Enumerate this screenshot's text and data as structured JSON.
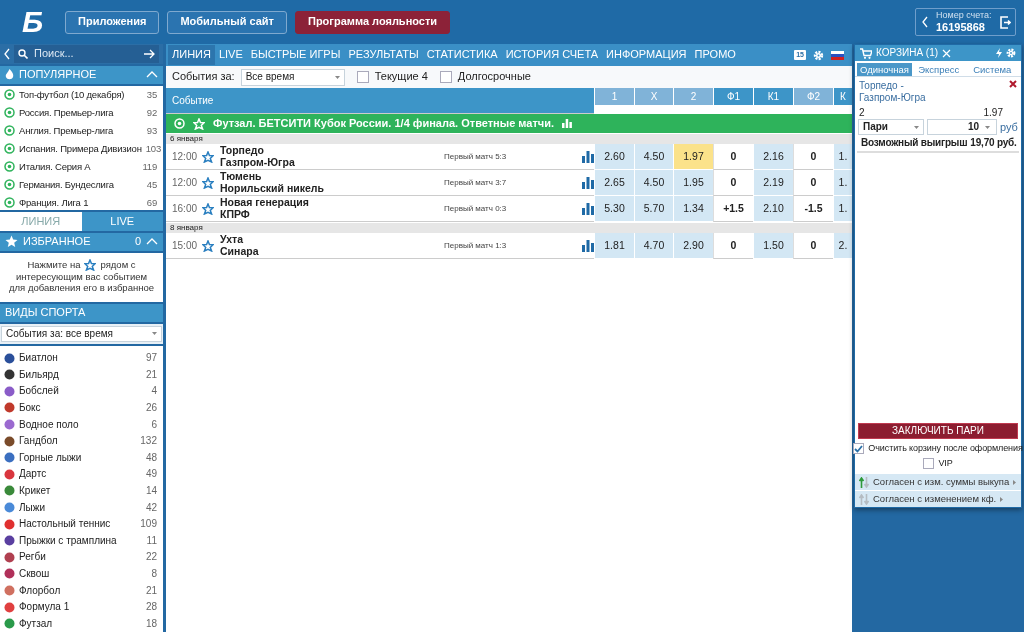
{
  "header": {
    "logo": "Б",
    "buttons": [
      {
        "label": "Приложения",
        "kind": "outline"
      },
      {
        "label": "Мобильный сайт",
        "kind": "outline"
      },
      {
        "label": "Программа лояльности",
        "kind": "accent"
      }
    ],
    "account": {
      "label": "Номер счета:",
      "number": "16195868"
    }
  },
  "search": {
    "placeholder": "Поиск..."
  },
  "nav": {
    "tabs": [
      {
        "label": "ЛИНИЯ",
        "selected": true
      },
      {
        "label": "LIVE",
        "selected": false
      },
      {
        "label": "БЫСТРЫЕ ИГРЫ",
        "selected": false
      },
      {
        "label": "РЕЗУЛЬТАТЫ",
        "selected": false
      },
      {
        "label": "СТАТИСТИКА",
        "selected": false
      },
      {
        "label": "ИСТОРИЯ СЧЕТА",
        "selected": false
      },
      {
        "label": "ИНФОРМАЦИЯ",
        "selected": false
      },
      {
        "label": "ПРОМО",
        "selected": false
      }
    ],
    "badge": "15"
  },
  "popular": {
    "title": "ПОПУЛЯРНОЕ",
    "items": [
      {
        "name": "Топ-футбол (10 декабря)",
        "count": "35"
      },
      {
        "name": "Россия. Премьер-лига",
        "count": "92"
      },
      {
        "name": "Англия. Премьер-лига",
        "count": "93"
      },
      {
        "name": "Испания. Примера Дивизион",
        "count": "103"
      },
      {
        "name": "Италия. Серия А",
        "count": "119"
      },
      {
        "name": "Германия. Бундеслига",
        "count": "45"
      },
      {
        "name": "Франция. Лига 1",
        "count": "69"
      }
    ]
  },
  "side_tabs": [
    {
      "label": "ЛИНИЯ",
      "selected": false
    },
    {
      "label": "LIVE",
      "selected": true
    }
  ],
  "favorites": {
    "title": "ИЗБРАННОЕ",
    "count": "0",
    "hint_start": "Нажмите на",
    "hint_mid": "рядом с",
    "hint_end": "интересующим вас событием для добавления его в избранное"
  },
  "sports": {
    "title": "ВИДЫ СПОРТА",
    "filter": "События за: все время",
    "items": [
      {
        "name": "Биатлон",
        "count": "97",
        "color": "#2a4f9a"
      },
      {
        "name": "Бильярд",
        "count": "21",
        "color": "#333333"
      },
      {
        "name": "Бобслей",
        "count": "4",
        "color": "#8a5cc8"
      },
      {
        "name": "Бокс",
        "count": "26",
        "color": "#c0392b"
      },
      {
        "name": "Водное поло",
        "count": "6",
        "color": "#9b6ad0"
      },
      {
        "name": "Гандбол",
        "count": "132",
        "color": "#7a4b2a"
      },
      {
        "name": "Горные лыжи",
        "count": "48",
        "color": "#3b6fc0"
      },
      {
        "name": "Дартс",
        "count": "49",
        "color": "#d9363e"
      },
      {
        "name": "Крикет",
        "count": "14",
        "color": "#3a8a3a"
      },
      {
        "name": "Лыжи",
        "count": "42",
        "color": "#4a8ad8"
      },
      {
        "name": "Настольный теннис",
        "count": "109",
        "color": "#e0302f"
      },
      {
        "name": "Прыжки с трамплина",
        "count": "11",
        "color": "#5a3fa0"
      },
      {
        "name": "Регби",
        "count": "22",
        "color": "#b04050"
      },
      {
        "name": "Сквош",
        "count": "8",
        "color": "#b0305a"
      },
      {
        "name": "Флорбол",
        "count": "21",
        "color": "#d07060"
      },
      {
        "name": "Формула 1",
        "count": "28",
        "color": "#e04040"
      },
      {
        "name": "Футзал",
        "count": "18",
        "color": "#2a9a4a"
      }
    ]
  },
  "filters": {
    "label": "События за:",
    "period": "Все время",
    "checkboxes": [
      {
        "label": "Текущие 4",
        "checked": false
      },
      {
        "label": "Долгосрочные",
        "checked": false
      }
    ]
  },
  "table": {
    "columns": [
      {
        "label": "Событие",
        "shaded": false,
        "kind": "event"
      },
      {
        "label": "1",
        "shaded": true,
        "kind": "odds"
      },
      {
        "label": "X",
        "shaded": true,
        "kind": "odds"
      },
      {
        "label": "2",
        "shaded": true,
        "kind": "odds"
      },
      {
        "label": "Ф1",
        "shaded": false,
        "kind": "handicap"
      },
      {
        "label": "К1",
        "shaded": false,
        "kind": "odds"
      },
      {
        "label": "Ф2",
        "shaded": true,
        "kind": "handicap"
      },
      {
        "label": "К",
        "shaded": false,
        "kind": "odds"
      }
    ],
    "league": "Футзал. БЕТСИТИ Кубок России. 1/4 финала. Ответные матчи.",
    "groups": [
      {
        "date": "6 января",
        "rows": [
          {
            "time": "12:00",
            "team1": "Торпедо",
            "team2": "Газпром-Югра",
            "note": "Первый матч 5:3",
            "odds": [
              {
                "value": "2.60",
                "selected": false
              },
              {
                "value": "4.50",
                "selected": false
              },
              {
                "value": "1.97",
                "selected": true
              },
              {
                "value": "0",
                "selected": false
              },
              {
                "value": "2.16",
                "selected": false
              },
              {
                "value": "0",
                "selected": false
              },
              {
                "value": "1.",
                "selected": false
              }
            ]
          },
          {
            "time": "12:00",
            "team1": "Тюмень",
            "team2": "Норильский никель",
            "note": "Первый матч 3:7",
            "odds": [
              {
                "value": "2.65",
                "selected": false
              },
              {
                "value": "4.50",
                "selected": false
              },
              {
                "value": "1.95",
                "selected": false
              },
              {
                "value": "0",
                "selected": false
              },
              {
                "value": "2.19",
                "selected": false
              },
              {
                "value": "0",
                "selected": false
              },
              {
                "value": "1.",
                "selected": false
              }
            ]
          },
          {
            "time": "16:00",
            "team1": "Новая генерация",
            "team2": "КПРФ",
            "note": "Первый матч 0:3",
            "odds": [
              {
                "value": "5.30",
                "selected": false
              },
              {
                "value": "5.70",
                "selected": false
              },
              {
                "value": "1.34",
                "selected": false
              },
              {
                "value": "+1.5",
                "selected": false
              },
              {
                "value": "2.10",
                "selected": false
              },
              {
                "value": "-1.5",
                "selected": false
              },
              {
                "value": "1.",
                "selected": false
              }
            ]
          }
        ]
      },
      {
        "date": "8 января",
        "rows": [
          {
            "time": "15:00",
            "team1": "Ухта",
            "team2": "Синара",
            "note": "Первый матч 1:3",
            "odds": [
              {
                "value": "1.81",
                "selected": false
              },
              {
                "value": "4.70",
                "selected": false
              },
              {
                "value": "2.90",
                "selected": false
              },
              {
                "value": "0",
                "selected": false
              },
              {
                "value": "1.50",
                "selected": false
              },
              {
                "value": "0",
                "selected": false
              },
              {
                "value": "2.",
                "selected": false
              }
            ]
          }
        ]
      }
    ]
  },
  "coupon": {
    "title": "КОРЗИНА (1)",
    "tabs": [
      {
        "label": "Одиночная",
        "selected": true
      },
      {
        "label": "Экспресс",
        "selected": false
      },
      {
        "label": "Система",
        "selected": false
      }
    ],
    "bet": {
      "event": "Торпедо - Газпром-Югра",
      "outcome": "2",
      "odds": "1.97",
      "type": "Пари",
      "stake": "10",
      "currency": "руб",
      "win_label": "Возможный выигрыш",
      "win": "19,70 руб."
    },
    "submit": "ЗАКЛЮЧИТЬ ПАРИ",
    "options": [
      {
        "label": "Очистить корзину после оформления",
        "checked": true
      },
      {
        "label": "VIP",
        "checked": false
      }
    ],
    "agreements": [
      {
        "label": "Согласен с изм. суммы выкупа",
        "on": true
      },
      {
        "label": "Согласен с изменением кф.",
        "on": false
      }
    ]
  }
}
